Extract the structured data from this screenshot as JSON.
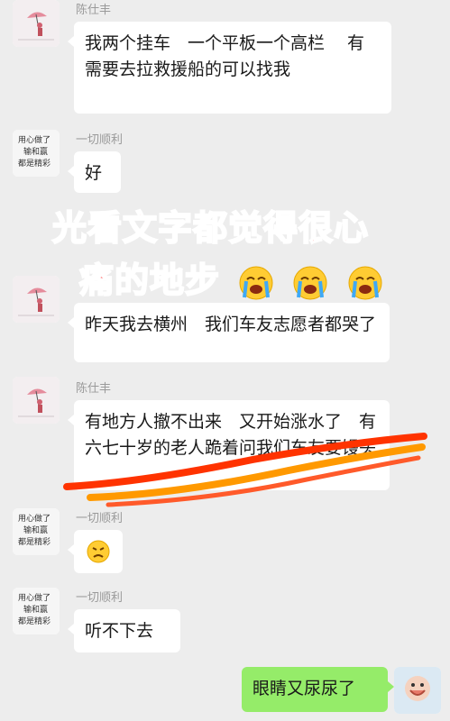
{
  "messages": [
    {
      "sender": "陈仕丰",
      "text": "我两个挂车　一个平板一个高栏　 有需要去拉救援船的可以找我"
    },
    {
      "sender": "一切顺利",
      "text": "好"
    },
    {
      "sender": "",
      "text": "昨天我去横州　我们车友志愿者都哭了"
    },
    {
      "sender": "陈仕丰",
      "text": "有地方人撤不出来　又开始涨水了　有六七十岁的老人跪着问我们车友要馒头"
    },
    {
      "sender": "一切顺利",
      "text": ""
    },
    {
      "sender": "一切顺利",
      "text": "听不下去"
    },
    {
      "sender": "me",
      "text": "眼睛又尿尿了"
    }
  ],
  "overlay": {
    "line1": "光看文字都觉得很心",
    "line2": "痛的地步",
    "emoji_icon": "loudly-crying-face-icon"
  },
  "avatar_text": {
    "line1": "用心做了",
    "line2": "输和赢",
    "line3": "都是精彩"
  },
  "colors": {
    "bg": "#ededed",
    "me_bubble": "#95ec69",
    "overlay": "#ff2d2d",
    "underline1": "#ff3300",
    "underline2": "#ff9900"
  }
}
